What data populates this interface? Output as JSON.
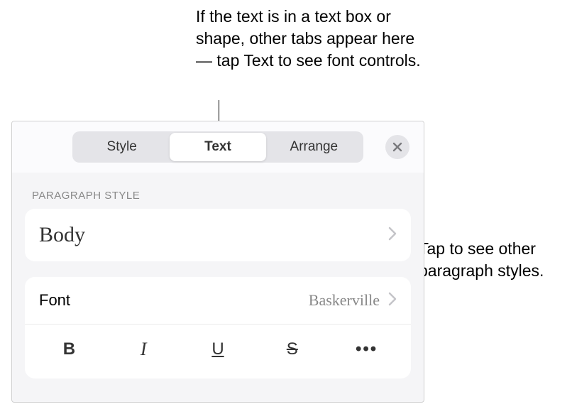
{
  "annotations": {
    "top": "If the text is in a text box or shape, other tabs appear here — tap Text to see font controls.",
    "right": "Tap to see other paragraph styles."
  },
  "tabs": {
    "style": "Style",
    "text": "Text",
    "arrange": "Arrange"
  },
  "section_label": "PARAGRAPH STYLE",
  "paragraph_style": {
    "current": "Body"
  },
  "font_row": {
    "label": "Font",
    "value": "Baskerville"
  },
  "format": {
    "bold": "B",
    "italic": "I",
    "underline": "U",
    "strike": "S",
    "more": "•••"
  }
}
